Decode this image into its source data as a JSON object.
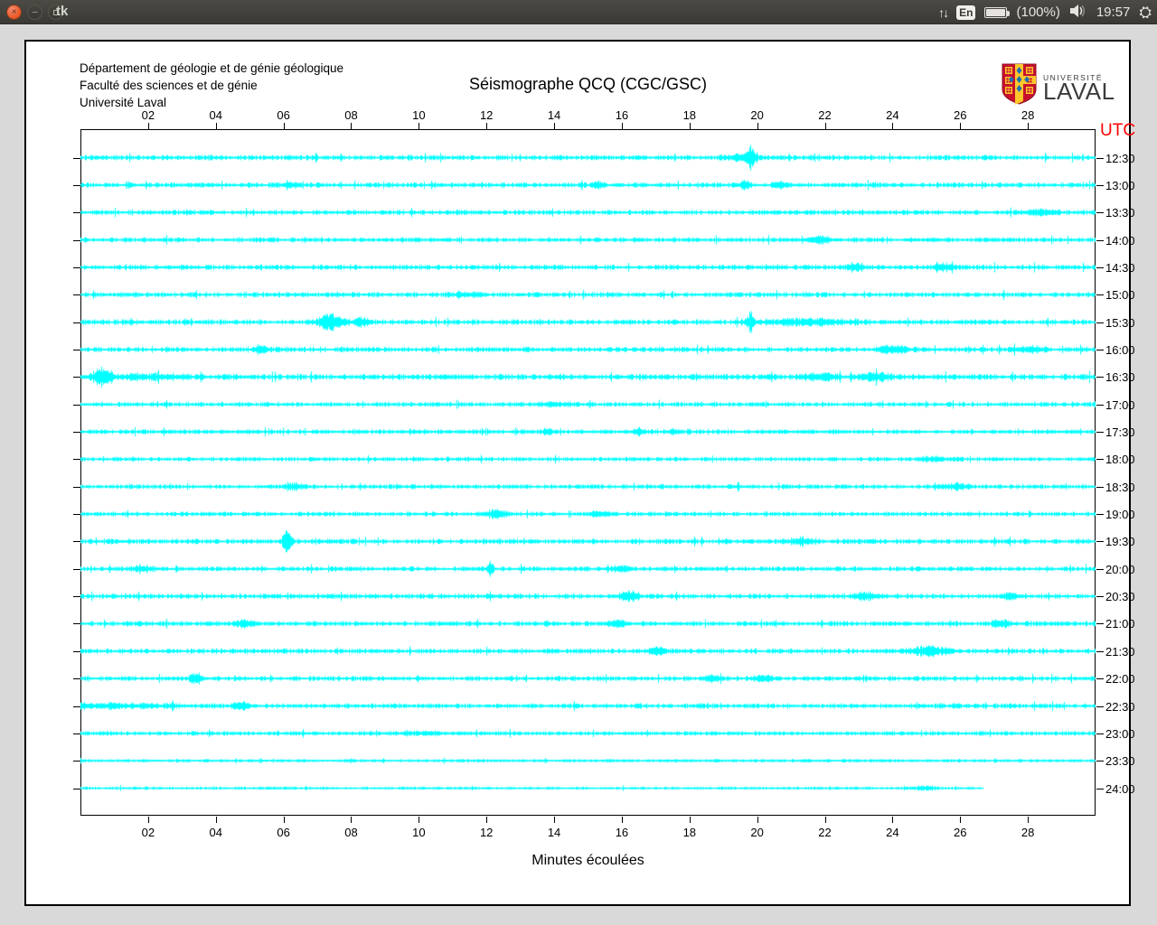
{
  "window": {
    "title": "tk",
    "controls": {
      "close": "×",
      "minimize": "–",
      "maximize": ""
    }
  },
  "panel": {
    "network_icon": "↑↓",
    "keyboard_indicator": "En",
    "battery_label": "(100%)",
    "volume_icon": "speaker",
    "clock": "19:57",
    "session_icon": "⛭"
  },
  "header": {
    "lines": [
      "Département de géologie et de génie géologique",
      "Faculté des sciences et de génie",
      "Université Laval"
    ],
    "title": "Séismographe QCQ (CGC/GSC)"
  },
  "logo": {
    "text_top": "UNIVERSITÉ",
    "text_bottom": "LAVAL",
    "shield_colors": {
      "red": "#c8102e",
      "gold": "#ffc72c",
      "blue": "#1f6fb2"
    }
  },
  "chart_data": {
    "type": "line",
    "variant": "seismogram-helicorder",
    "title": "Séismographe QCQ (CGC/GSC)",
    "xlabel": "Minutes écoulées",
    "right_axis_title": "UTC",
    "right_axis_title_color": "#ff0000",
    "trace_color": "#00ffff",
    "x_range_minutes": [
      0,
      30
    ],
    "x_ticks": [
      "02",
      "04",
      "06",
      "08",
      "10",
      "12",
      "14",
      "16",
      "18",
      "20",
      "22",
      "24",
      "26",
      "28"
    ],
    "grid": false,
    "legend": false,
    "rows": [
      {
        "utc": "12:30",
        "end_minute": 30,
        "scale": 1.0,
        "events": [
          [
            19.8,
            12,
            0.08
          ],
          [
            19.5,
            3,
            0.3
          ]
        ]
      },
      {
        "utc": "13:00",
        "end_minute": 30,
        "scale": 1.0,
        "events": [
          [
            6.2,
            2,
            0.2
          ],
          [
            15.3,
            3,
            0.1
          ],
          [
            19.6,
            4,
            0.12
          ],
          [
            20.7,
            3,
            0.15
          ]
        ]
      },
      {
        "utc": "13:30",
        "end_minute": 30,
        "scale": 0.95,
        "events": [
          [
            28.4,
            3,
            0.3
          ]
        ]
      },
      {
        "utc": "14:00",
        "end_minute": 30,
        "scale": 0.95,
        "events": [
          [
            21.8,
            3,
            0.25
          ]
        ]
      },
      {
        "utc": "14:30",
        "end_minute": 30,
        "scale": 1.0,
        "events": [
          [
            22.9,
            4,
            0.2
          ],
          [
            25.5,
            3,
            0.2
          ]
        ]
      },
      {
        "utc": "15:00",
        "end_minute": 30,
        "scale": 1.0,
        "events": [
          [
            11.5,
            2,
            0.3
          ]
        ]
      },
      {
        "utc": "15:30",
        "end_minute": 30,
        "scale": 1.05,
        "events": [
          [
            7.4,
            9,
            0.25
          ],
          [
            8.3,
            4,
            0.15
          ],
          [
            19.8,
            10,
            0.07
          ],
          [
            21.5,
            3,
            0.8
          ]
        ]
      },
      {
        "utc": "16:00",
        "end_minute": 30,
        "scale": 1.0,
        "events": [
          [
            5.3,
            3,
            0.15
          ],
          [
            24.0,
            4,
            0.3
          ],
          [
            28.0,
            3,
            0.3
          ]
        ]
      },
      {
        "utc": "16:30",
        "end_minute": 30,
        "scale": 1.15,
        "events": [
          [
            0.6,
            10,
            0.15
          ],
          [
            2.0,
            2,
            1.0
          ],
          [
            21.9,
            4,
            0.3
          ],
          [
            23.5,
            4,
            0.3
          ]
        ]
      },
      {
        "utc": "17:00",
        "end_minute": 30,
        "scale": 0.9,
        "events": [
          [
            14.0,
            1.5,
            0.5
          ]
        ]
      },
      {
        "utc": "17:30",
        "end_minute": 30,
        "scale": 0.9,
        "events": [
          [
            13.8,
            3,
            0.1
          ],
          [
            16.5,
            3,
            0.15
          ],
          [
            17.5,
            2,
            0.1
          ]
        ]
      },
      {
        "utc": "18:00",
        "end_minute": 30,
        "scale": 0.85,
        "events": [
          [
            25.2,
            2,
            0.3
          ]
        ]
      },
      {
        "utc": "18:30",
        "end_minute": 30,
        "scale": 0.9,
        "events": [
          [
            6.3,
            3,
            0.2
          ],
          [
            25.9,
            3,
            0.25
          ]
        ]
      },
      {
        "utc": "19:00",
        "end_minute": 30,
        "scale": 0.9,
        "events": [
          [
            12.3,
            4,
            0.2
          ],
          [
            15.3,
            3,
            0.2
          ]
        ]
      },
      {
        "utc": "19:30",
        "end_minute": 30,
        "scale": 1.0,
        "events": [
          [
            6.1,
            12,
            0.1
          ],
          [
            21.3,
            4,
            0.25
          ]
        ]
      },
      {
        "utc": "20:00",
        "end_minute": 30,
        "scale": 0.95,
        "events": [
          [
            1.8,
            3,
            0.2
          ],
          [
            12.1,
            8,
            0.06
          ],
          [
            16.0,
            3,
            0.2
          ]
        ]
      },
      {
        "utc": "20:30",
        "end_minute": 30,
        "scale": 1.0,
        "events": [
          [
            16.2,
            5,
            0.2
          ],
          [
            23.2,
            4,
            0.25
          ],
          [
            27.5,
            3,
            0.2
          ]
        ]
      },
      {
        "utc": "21:00",
        "end_minute": 30,
        "scale": 1.0,
        "events": [
          [
            4.8,
            4,
            0.15
          ],
          [
            15.9,
            3,
            0.2
          ],
          [
            27.2,
            3,
            0.2
          ]
        ]
      },
      {
        "utc": "21:30",
        "end_minute": 30,
        "scale": 0.95,
        "events": [
          [
            17.0,
            3,
            0.2
          ],
          [
            25.1,
            5,
            0.4
          ]
        ]
      },
      {
        "utc": "22:00",
        "end_minute": 30,
        "scale": 0.95,
        "events": [
          [
            3.4,
            6,
            0.12
          ],
          [
            18.7,
            3,
            0.2
          ],
          [
            20.2,
            3,
            0.2
          ]
        ]
      },
      {
        "utc": "22:30",
        "end_minute": 30,
        "scale": 1.0,
        "events": [
          [
            0.5,
            2,
            1.5
          ],
          [
            4.7,
            4,
            0.15
          ]
        ]
      },
      {
        "utc": "23:00",
        "end_minute": 30,
        "scale": 0.85,
        "events": [
          [
            10.0,
            1.5,
            0.5
          ]
        ]
      },
      {
        "utc": "23:30",
        "end_minute": 30,
        "scale": 0.65,
        "events": []
      },
      {
        "utc": "24:00",
        "end_minute": 26.7,
        "scale": 0.55,
        "events": [
          [
            25.0,
            2,
            0.2
          ]
        ]
      }
    ]
  }
}
